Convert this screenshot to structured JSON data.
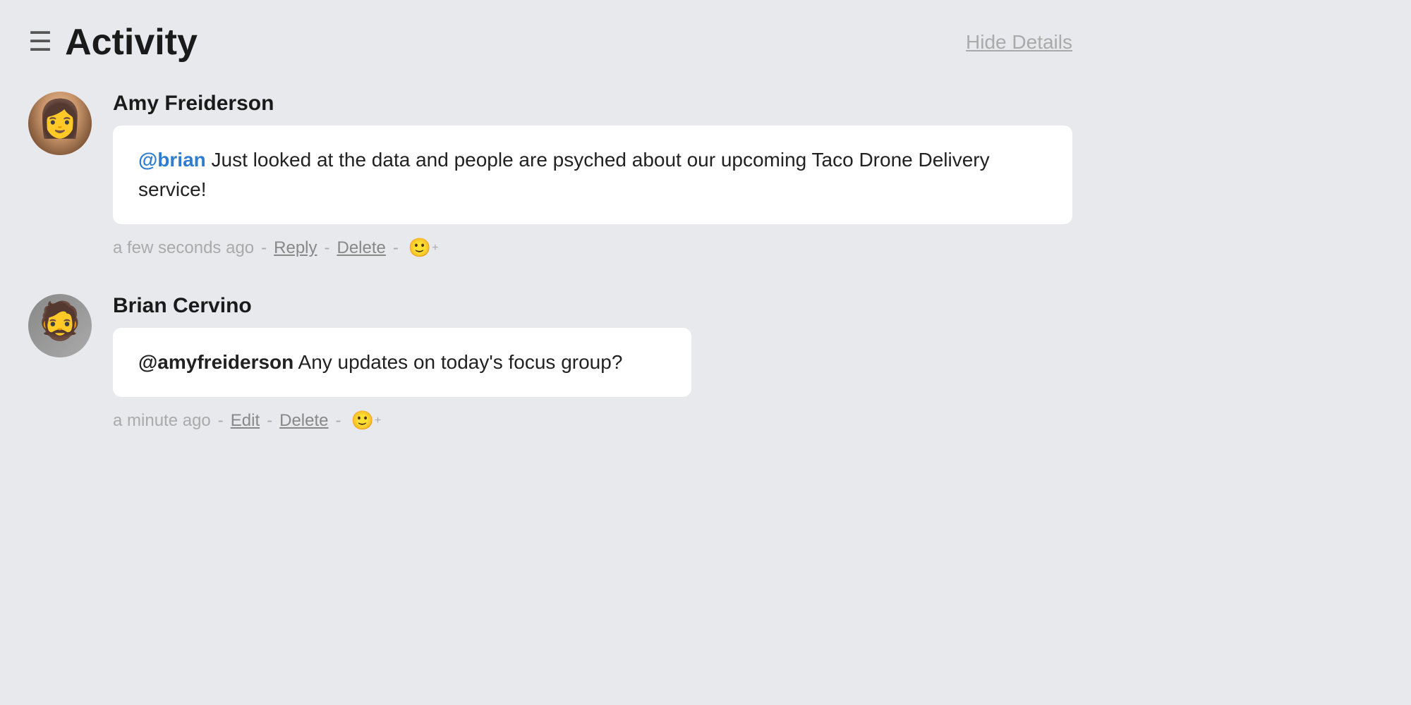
{
  "header": {
    "title": "Activity",
    "hide_details_label": "Hide Details",
    "icon": "☰"
  },
  "activity_items": [
    {
      "id": "amy",
      "user_name": "Amy Freiderson",
      "avatar_emoji": "👩",
      "message_mention": "@brian",
      "message_body": " Just looked at the data and people are psyched about our upcoming Taco Drone Delivery service!",
      "timestamp": "a few seconds ago",
      "actions": [
        "Reply",
        "Delete"
      ],
      "action_separator": "-"
    },
    {
      "id": "brian",
      "user_name": "Brian Cervino",
      "avatar_emoji": "🧔",
      "message_mention": "@amyfreiderson",
      "message_body": " Any updates on today's focus group?",
      "timestamp": "a minute ago",
      "actions": [
        "Edit",
        "Delete"
      ],
      "action_separator": "-"
    }
  ]
}
